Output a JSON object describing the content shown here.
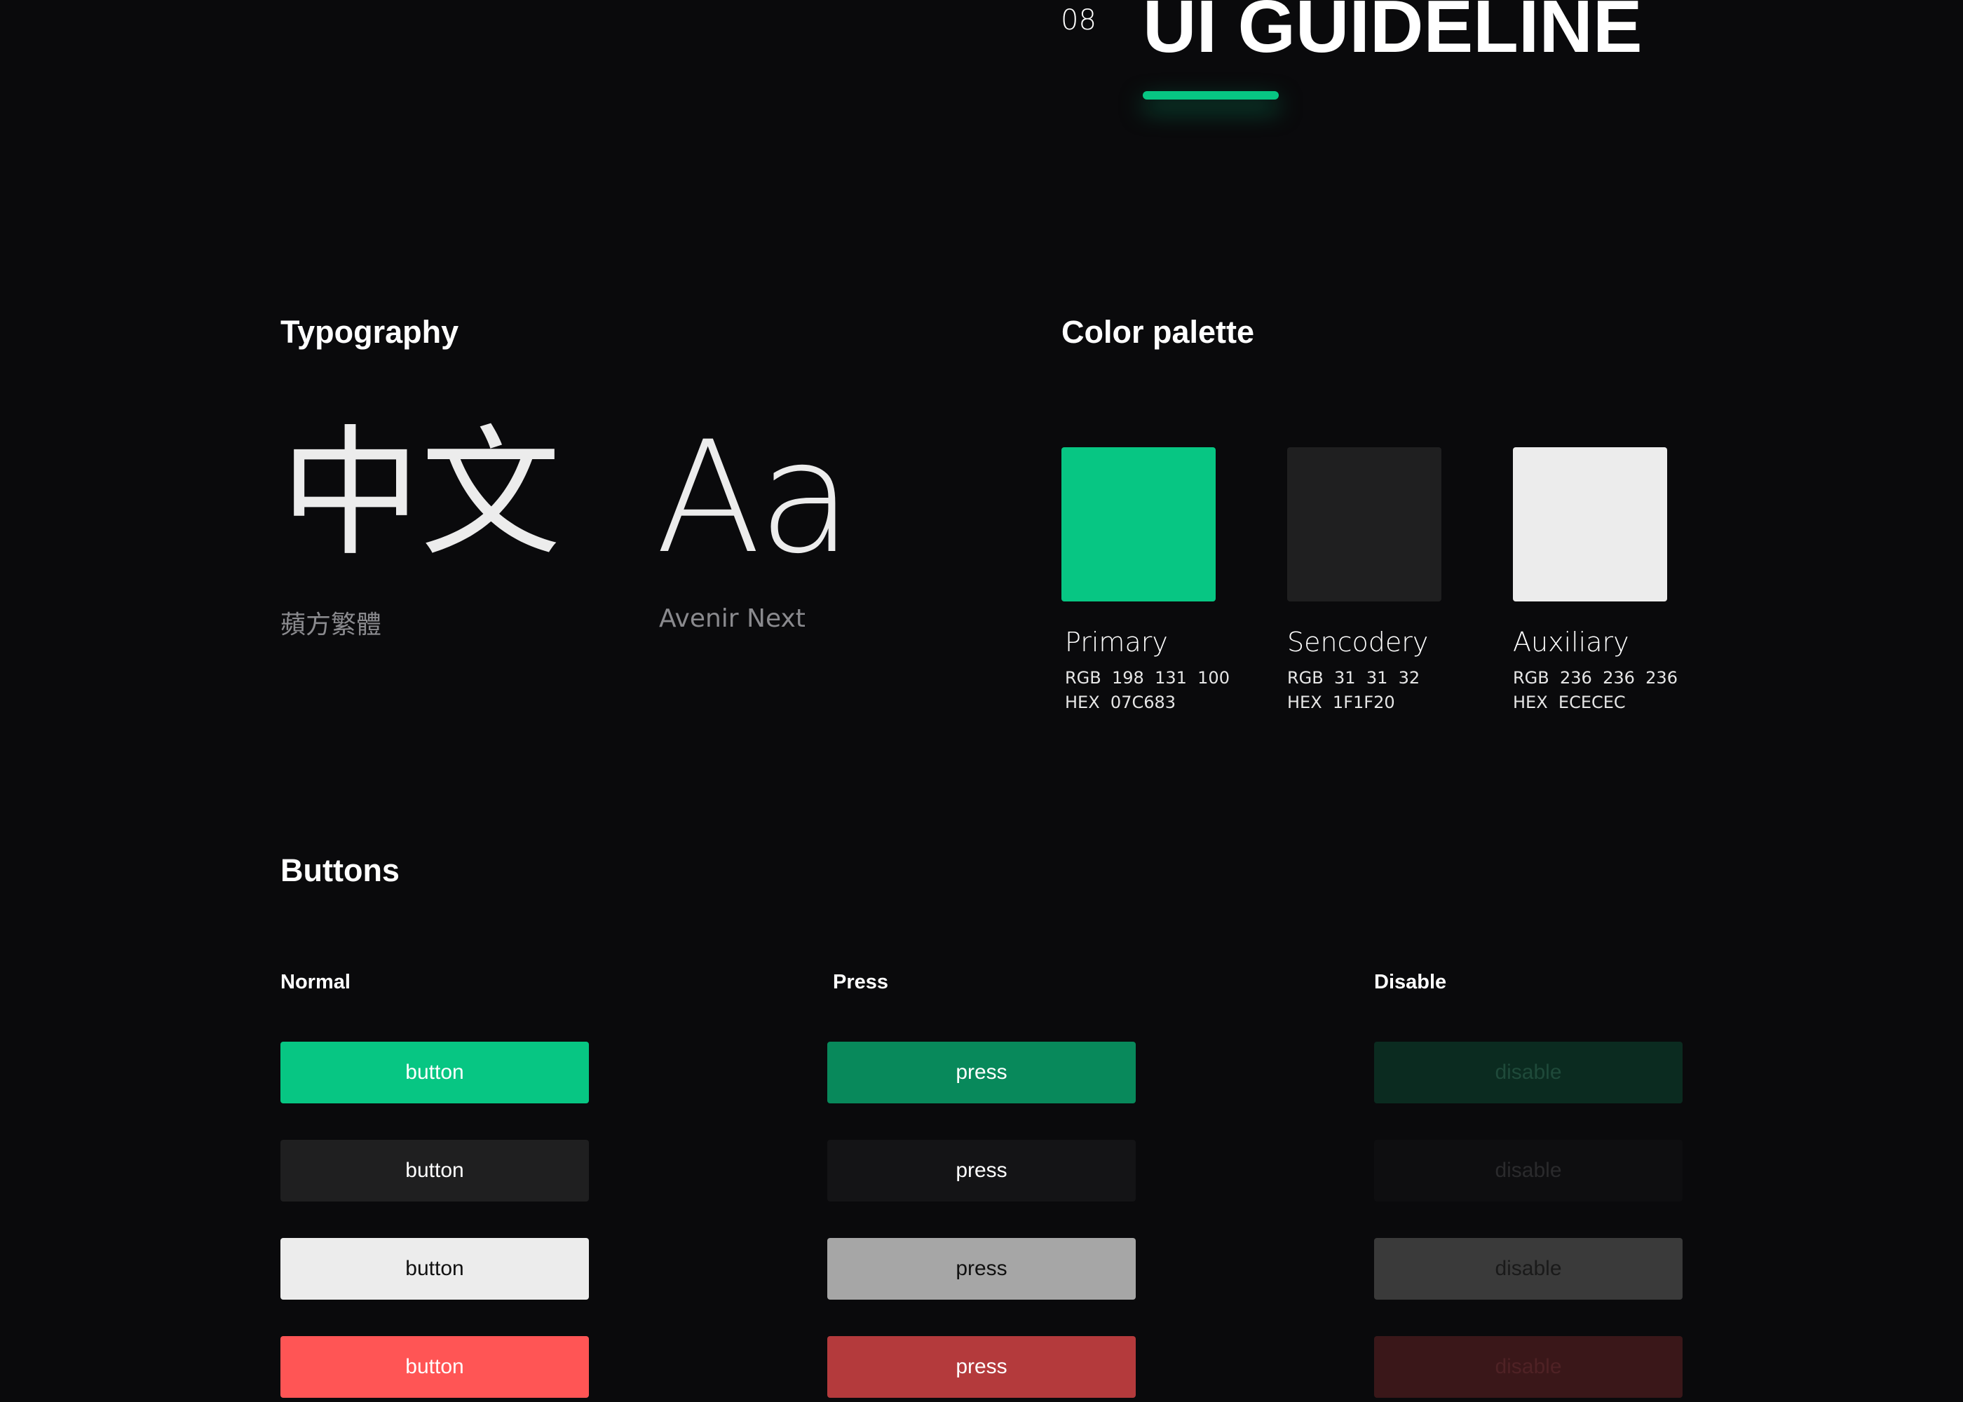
{
  "header": {
    "section_number": "08",
    "title": "UI GUIDELINE"
  },
  "typography": {
    "heading": "Typography",
    "samples": [
      {
        "glyph": "中文",
        "font_name": "蘋方繁體"
      },
      {
        "glyph": "Aa",
        "font_name": "Avenir Next"
      }
    ]
  },
  "palette": {
    "heading": "Color palette",
    "colors": [
      {
        "name": "Primary",
        "rgb_label": "RGB",
        "rgb": "198  131  100",
        "hex_label": "HEX",
        "hex": "07C683",
        "swatch": "#07c683"
      },
      {
        "name": "Sencodery",
        "rgb_label": "RGB",
        "rgb": "31  31  32",
        "hex_label": "HEX",
        "hex": "1F1F20",
        "swatch": "#1f1f20"
      },
      {
        "name": "Auxiliary",
        "rgb_label": "RGB",
        "rgb": "236  236  236",
        "hex_label": "HEX",
        "hex": "ECECEC",
        "swatch": "#ececec"
      }
    ]
  },
  "buttons": {
    "heading": "Buttons",
    "states": [
      "Normal",
      "Press",
      "Disable"
    ],
    "normal": {
      "label": "button",
      "variants": [
        {
          "bg": "#07c683",
          "fg": "#ffffff"
        },
        {
          "bg": "#1f1f20",
          "fg": "#ffffff"
        },
        {
          "bg": "#ececec",
          "fg": "#111111"
        },
        {
          "bg": "#ff5555",
          "fg": "#ffffff"
        }
      ]
    },
    "press": {
      "label": "press",
      "variants": [
        {
          "bg": "#08895b",
          "fg": "#ffffff"
        },
        {
          "bg": "#141416",
          "fg": "#ffffff"
        },
        {
          "bg": "#a6a6a6",
          "fg": "#111111"
        },
        {
          "bg": "#b43a3c",
          "fg": "#ffffff"
        }
      ]
    },
    "disable": {
      "label": "disable",
      "variants": [
        {
          "bg": "#0b2b20",
          "fg": "#1f4a3a"
        },
        {
          "bg": "#0e0e10",
          "fg": "#2a2a2c"
        },
        {
          "bg": "#3a3a3a",
          "fg": "#1a1a1a"
        },
        {
          "bg": "#3a1719",
          "fg": "#4f2225"
        }
      ]
    }
  }
}
